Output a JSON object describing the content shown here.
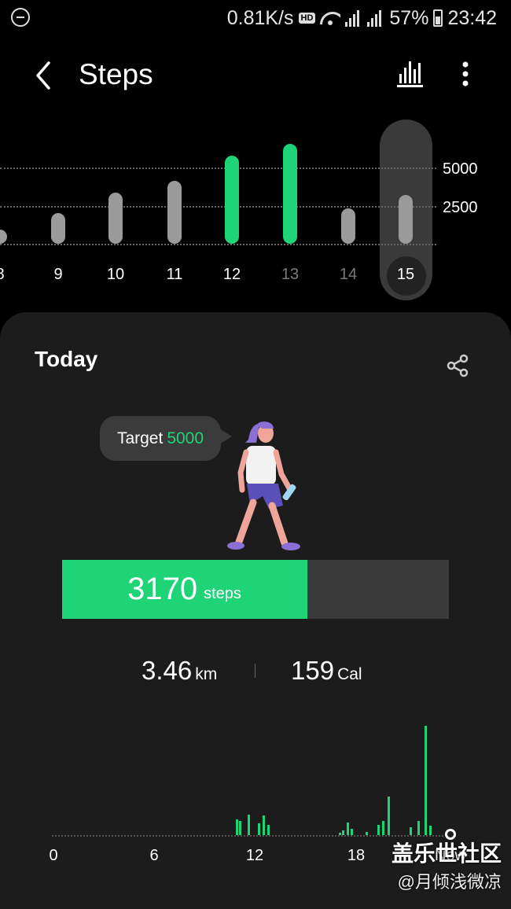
{
  "status_bar": {
    "net_speed": "0.81K/s",
    "hd_badge": "HD",
    "battery_pct": "57%",
    "time": "23:42"
  },
  "header": {
    "title": "Steps"
  },
  "week_chart": {
    "gridlines": [
      "5000",
      "2500"
    ],
    "days": [
      "8",
      "9",
      "10",
      "11",
      "12",
      "13",
      "14",
      "15"
    ],
    "steps": [
      800,
      2000,
      3300,
      4100,
      5700,
      6500,
      2300,
      3170
    ],
    "goal_reached": [
      false,
      false,
      false,
      false,
      true,
      true,
      false,
      false
    ],
    "selected_day": "15",
    "colors": {
      "goal": "#1ed477",
      "normal": "#9a9a9a",
      "future_label": "#7a7a7a"
    }
  },
  "today": {
    "title": "Today",
    "target_label": "Target",
    "target_value": "5000",
    "steps_value": "3170",
    "steps_unit": "steps",
    "progress_fraction": 0.634,
    "distance_value": "3.46",
    "distance_unit": "km",
    "calories_value": "159",
    "calories_unit": "Cal"
  },
  "hourly_chart": {
    "labels": [
      "0",
      "6",
      "12",
      "18",
      "Now"
    ],
    "bars": [
      {
        "hour": 10.8,
        "steps": 60
      },
      {
        "hour": 11.0,
        "steps": 55
      },
      {
        "hour": 11.5,
        "steps": 80
      },
      {
        "hour": 12.1,
        "steps": 45
      },
      {
        "hour": 12.4,
        "steps": 75
      },
      {
        "hour": 12.7,
        "steps": 40
      },
      {
        "hour": 16.9,
        "steps": 10
      },
      {
        "hour": 17.1,
        "steps": 18
      },
      {
        "hour": 17.4,
        "steps": 50
      },
      {
        "hour": 17.6,
        "steps": 25
      },
      {
        "hour": 18.5,
        "steps": 12
      },
      {
        "hour": 19.2,
        "steps": 40
      },
      {
        "hour": 19.5,
        "steps": 55
      },
      {
        "hour": 19.8,
        "steps": 150
      },
      {
        "hour": 21.1,
        "steps": 30
      },
      {
        "hour": 21.6,
        "steps": 55
      },
      {
        "hour": 22.0,
        "steps": 420
      },
      {
        "hour": 22.3,
        "steps": 35
      }
    ]
  },
  "watermark": {
    "line1": "盖乐世社区",
    "line2": "@月倾浅微凉"
  }
}
